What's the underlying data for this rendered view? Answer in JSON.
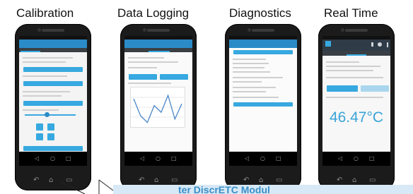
{
  "captions": [
    "Calibration",
    "Data Logging",
    "Diagnostics",
    "Real Time"
  ],
  "realtime": {
    "temperature": "46.47°C"
  },
  "datalogging": {
    "series": [
      0.75,
      0.25,
      0.05,
      0.55,
      0.35,
      0.85,
      0.15,
      0.6
    ]
  },
  "banner": {
    "text": "ter DiscrETC Modul"
  },
  "colors": {
    "accent": "#37a9e0",
    "appbar": "#2a8bc7",
    "temperature": "#3aa4d8",
    "banner_bg": "#d7e9f6"
  }
}
